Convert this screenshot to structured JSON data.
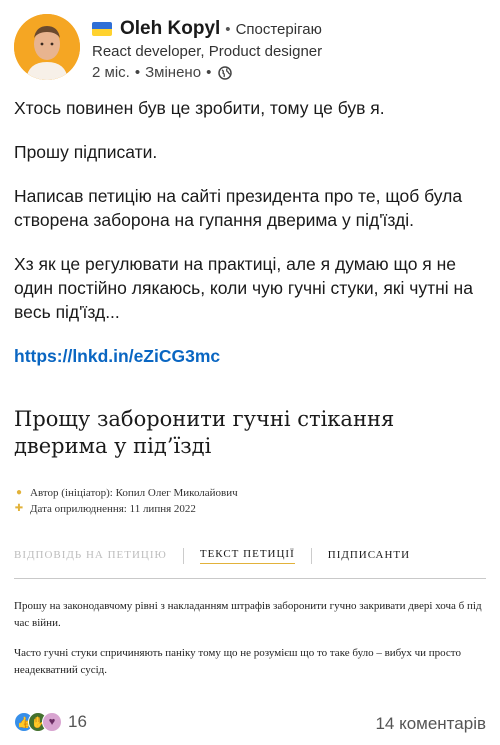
{
  "author": {
    "name": "Oleh Kopyl",
    "follow_label": "Спостерігаю",
    "headline": "React developer, Product designer",
    "time": "2 міс.",
    "edited": "Змінено",
    "visibility_icon": "globe-icon"
  },
  "post": {
    "paragraphs": [
      "Хтось повинен був це зробити, тому це був я.",
      "Прошу підписати.",
      "Написав петицію на сайті президента про те, щоб була створена заборона на гупання дверима у під'їзді.",
      "Хз як це регулювати на практиці, але я думаю що я не один постійно лякаюсь, коли чую гучні стуки, які чутні на весь під'їзд..."
    ],
    "link": "https://lnkd.in/eZiCG3mc"
  },
  "petition": {
    "title": "Прощу заборонити гучні стікання дверима у під’їзді",
    "author_line": "Автор (ініціатор): Копил Олег Миколайович",
    "date_line": "Дата оприлюднення: 11 липня 2022",
    "tabs": [
      "ВІДПОВІДЬ НА ПЕТИЦІЮ",
      "ТЕКСТ ПЕТИЦІЇ",
      "ПІДПИСАНТИ"
    ],
    "body": [
      "Прошу на законодавчому рівні з накладанням штрафів заборонити гучно закривати двері хоча б під час війни.",
      "Часто гучні стуки спричиняють паніку тому що не розумієш що то таке було – вибух чи просто неадекватний сусід."
    ]
  },
  "footer": {
    "reactions_count": "16",
    "comments": "14 коментарів"
  },
  "colors": {
    "link": "#0a66c2",
    "accent_underline": "#e2b23a",
    "avatar_bg": "#f5a623"
  }
}
